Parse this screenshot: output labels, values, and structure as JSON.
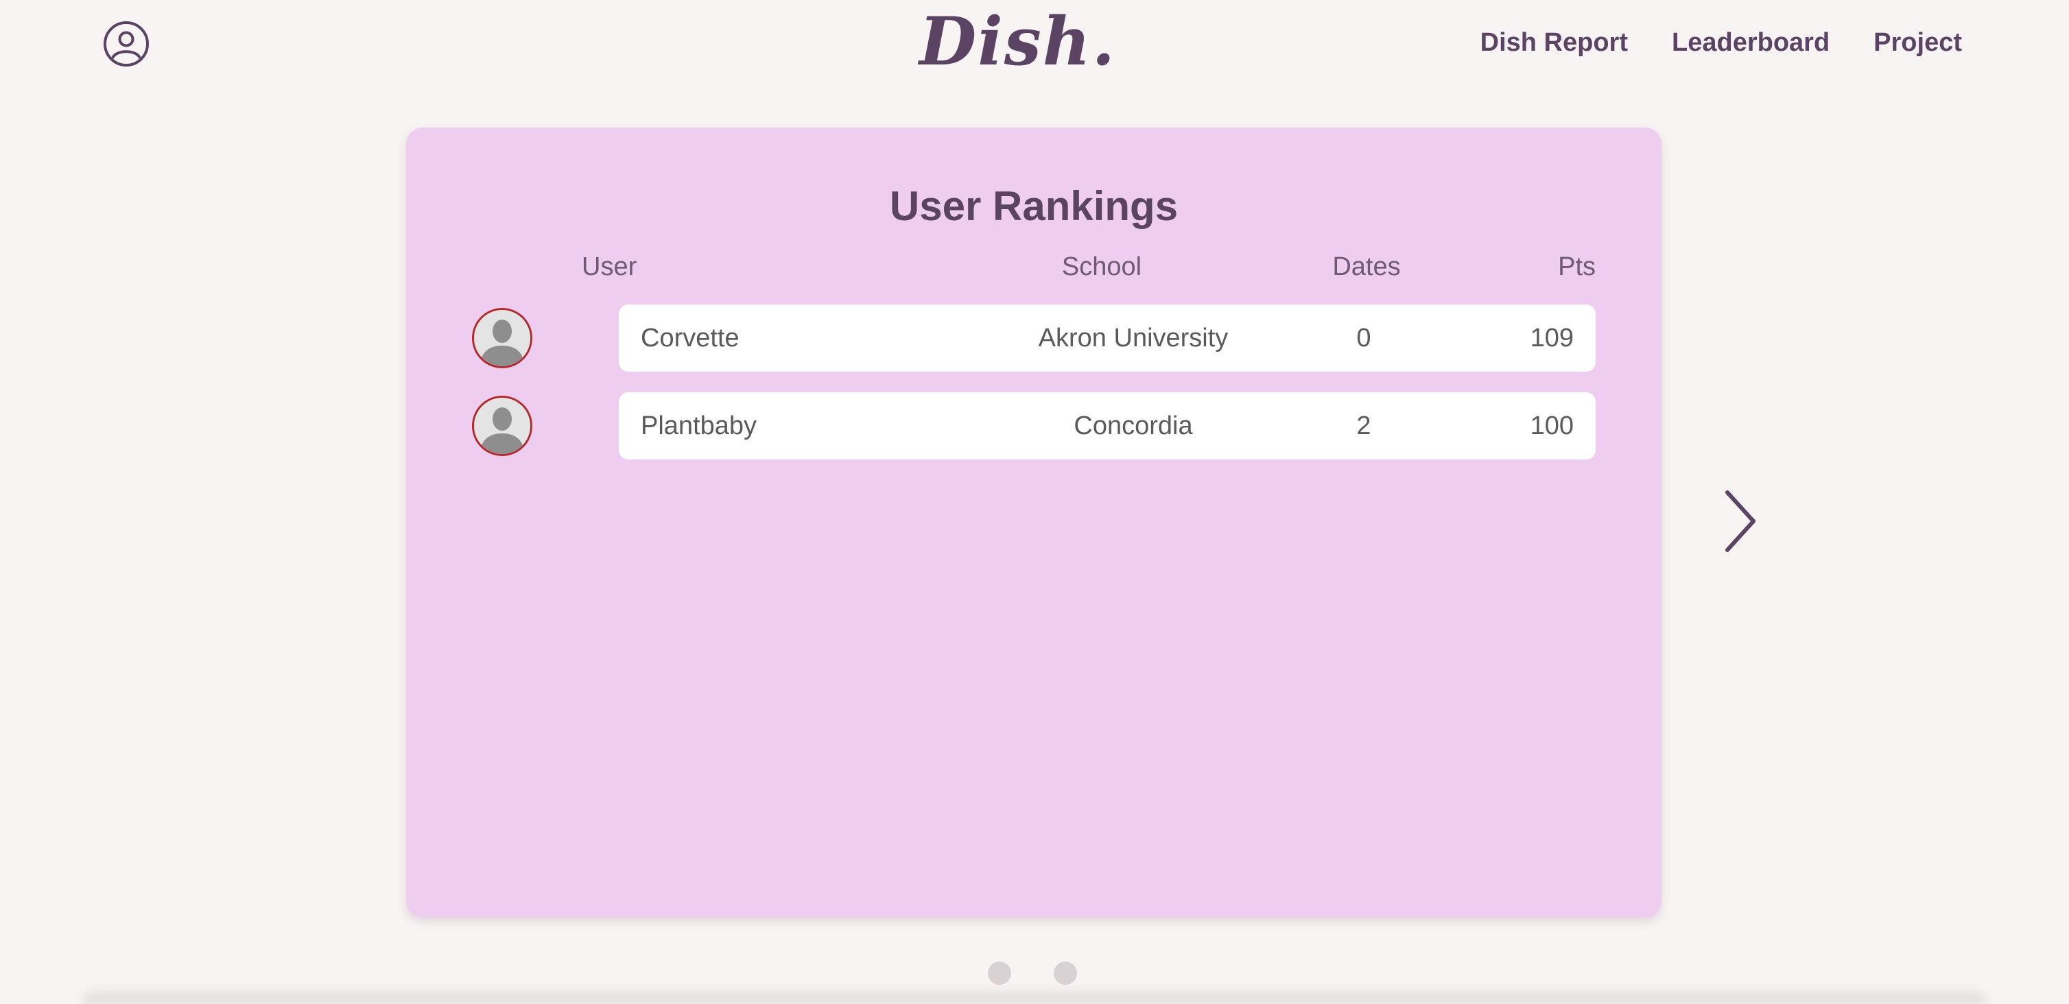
{
  "header": {
    "logo_text": "Dish.",
    "profile_icon": "user-circle-icon",
    "nav": [
      {
        "label": "Dish Report"
      },
      {
        "label": "Leaderboard"
      },
      {
        "label": "Project"
      }
    ]
  },
  "card": {
    "title": "User Rankings",
    "columns": {
      "user": "User",
      "school": "School",
      "dates": "Dates",
      "pts": "Pts"
    },
    "rows": [
      {
        "user": "Corvette",
        "school": "Akron University",
        "dates": "0",
        "pts": "109",
        "avatar_icon": "default-avatar-icon"
      },
      {
        "user": "Plantbaby",
        "school": "Concordia",
        "dates": "2",
        "pts": "100",
        "avatar_icon": "default-avatar-icon"
      }
    ],
    "next_icon": "chevron-right-icon"
  },
  "carousel": {
    "page_count": 2,
    "current_page": 1
  },
  "colors": {
    "background": "#f8f4f3",
    "card": "#efcdf1",
    "text_primary": "#5a4363",
    "avatar_border": "#b32a2a",
    "row_bg": "#ffffff",
    "dot": "#d8d2d4"
  }
}
